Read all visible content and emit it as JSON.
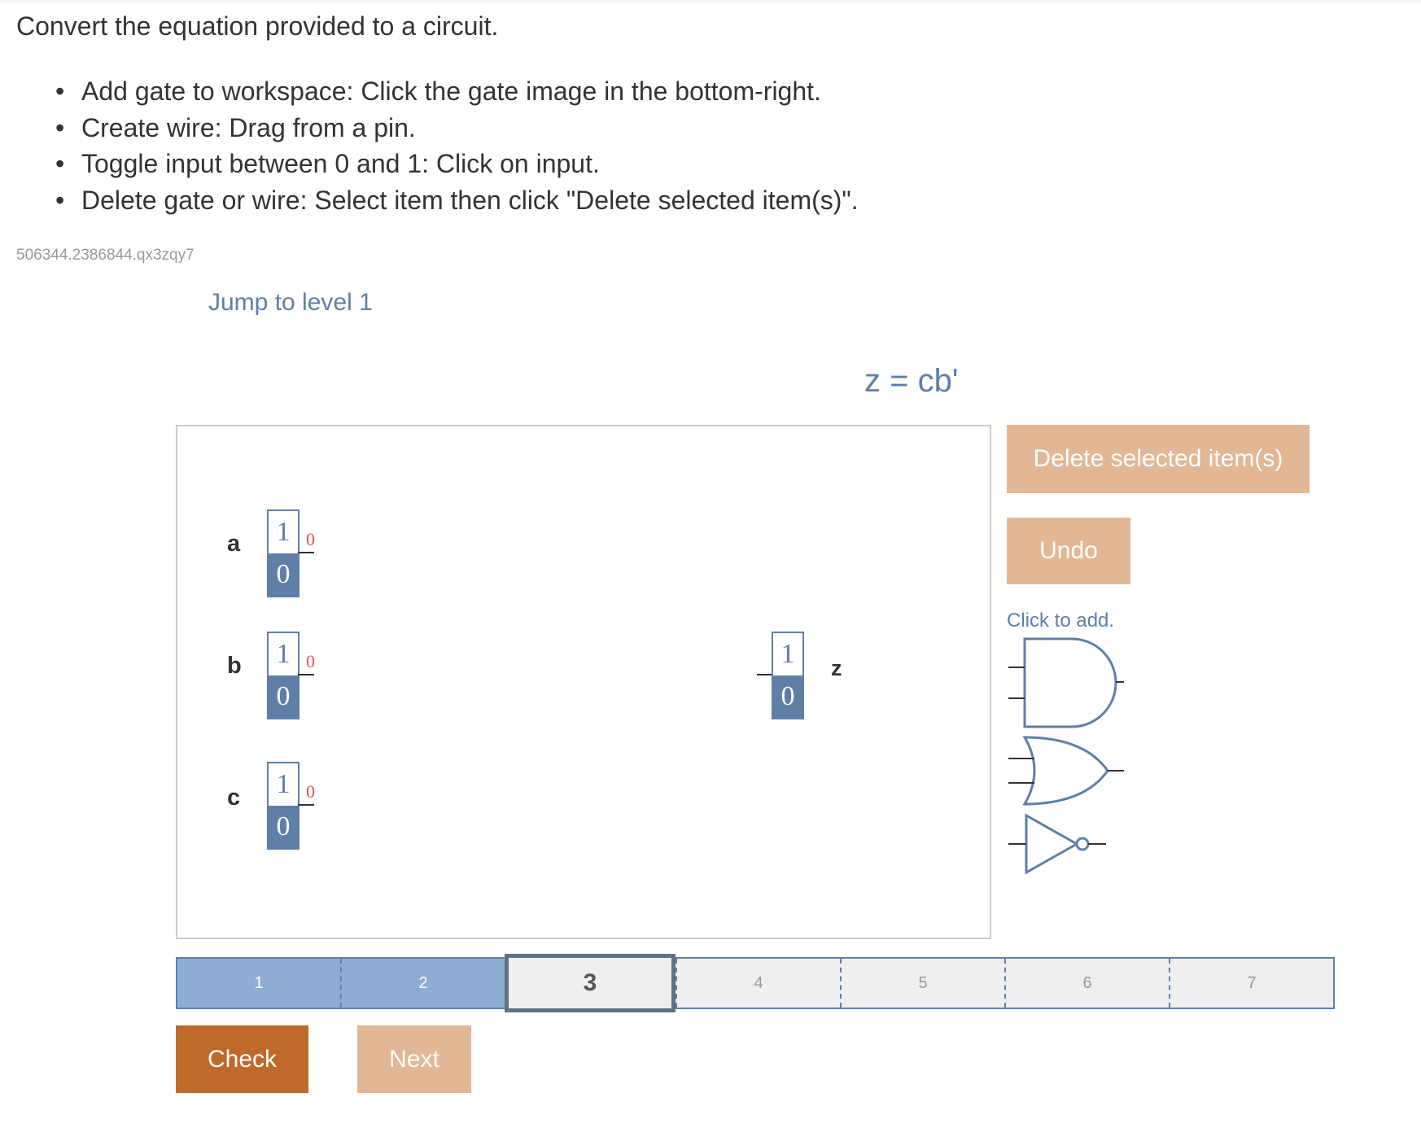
{
  "instructions": {
    "intro": "Convert the equation provided to a circuit.",
    "bullets": [
      "Add gate to workspace: Click the gate image in the bottom-right.",
      "Create wire: Drag from a pin.",
      "Toggle input between 0 and 1: Click on input.",
      "Delete gate or wire: Select item then click \"Delete selected item(s)\"."
    ]
  },
  "activity_id": "506344.2386844.qx3zqy7",
  "jump_link": "Jump to level 1",
  "equation": "z = cb'",
  "workspace": {
    "inputs": [
      {
        "label": "a",
        "top_value": "1",
        "bottom_value": "0",
        "output": "0"
      },
      {
        "label": "b",
        "top_value": "1",
        "bottom_value": "0",
        "output": "0"
      },
      {
        "label": "c",
        "top_value": "1",
        "bottom_value": "0",
        "output": "0"
      }
    ],
    "output": {
      "label": "z",
      "top_value": "1",
      "bottom_value": "0"
    }
  },
  "controls": {
    "delete_label": "Delete selected item(s)",
    "undo_label": "Undo",
    "click_to_add": "Click to add.",
    "gates": [
      "and-gate-icon",
      "or-gate-icon",
      "not-gate-icon"
    ]
  },
  "progress": {
    "levels": [
      "1",
      "2",
      "3",
      "4",
      "5",
      "6",
      "7"
    ],
    "completed": 2,
    "current": 3
  },
  "buttons": {
    "check_label": "Check",
    "next_label": "Next"
  },
  "colors": {
    "accent_blue": "#5f7fa8",
    "button_light": "#e2b795",
    "button_dark": "#bf6a2a",
    "progress_done": "#8eadd3",
    "output_red": "#d9534f"
  }
}
